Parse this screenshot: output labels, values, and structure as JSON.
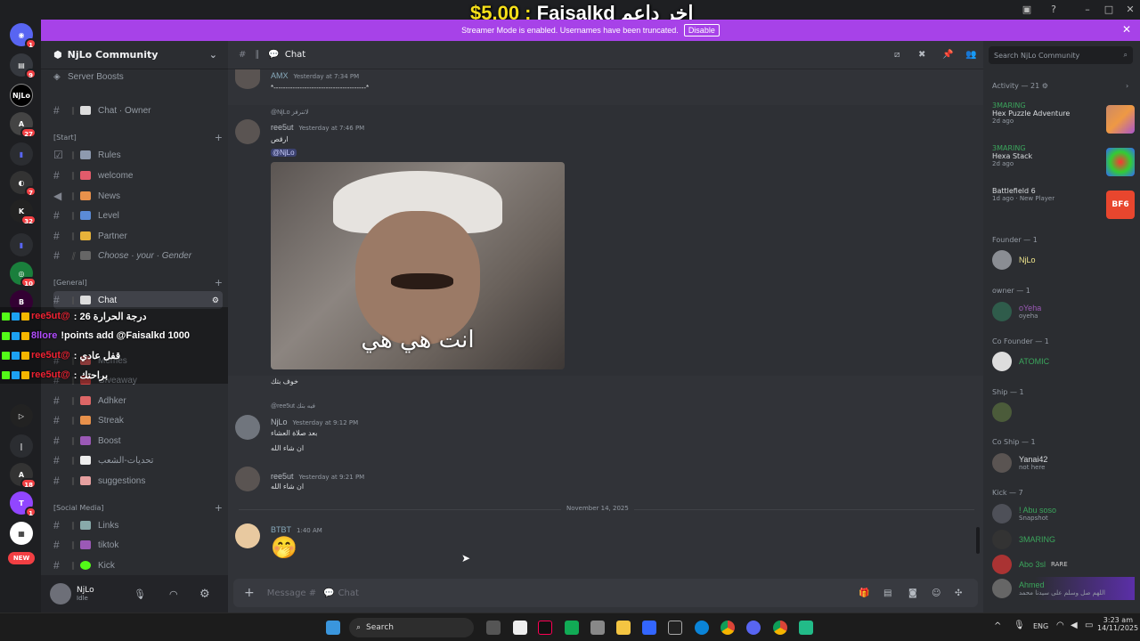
{
  "overlay": {
    "money": "$5.00 :",
    "name": "Faisalkd",
    "arabic": "اخر داعم"
  },
  "banner": {
    "text": "Streamer Mode is enabled. Usernames have been truncated.",
    "disable": "Disable"
  },
  "server": {
    "name": "NjLo Community",
    "boosts": "Server Boosts"
  },
  "channels": {
    "chat_owner": "Chat · Owner",
    "cat_start": "[Start]",
    "rules": "Rules",
    "welcome": "welcome",
    "news": "News",
    "level": "Level",
    "partner": "Partner",
    "gender": "Choose · your · Gender",
    "cat_general": "[General]",
    "chat": "Chat",
    "memes": "Memes",
    "giveaway": "Giveaway",
    "adhker": "Adhker",
    "streak": "Streak",
    "boost": "Boost",
    "challenges": "تحديات-الشعب",
    "suggestions": "suggestions",
    "cat_social": "[Social Media]",
    "links": "Links",
    "tiktok": "tiktok",
    "kick": "Kick"
  },
  "user": {
    "name": "NjLo",
    "status": "Idle"
  },
  "chat_overlay": [
    {
      "user": "ree5ut@",
      "text": ": درجة الحرارة 26"
    },
    {
      "user": "8llore",
      "text": "!points add @Faisalkd 1000"
    },
    {
      "user": "ree5ut@",
      "text": ": قفل عادي"
    },
    {
      "user": "ree5ut@",
      "text": ": براحتك"
    }
  ],
  "header": {
    "channel": "Chat"
  },
  "messages": {
    "m0_tag": "AMX",
    "m0_time": "Yesterday at 7:34 PM",
    "m0_text": "*---------------------------------------*",
    "m1_reply": "@NjLo لاتنرفز",
    "m1_user": "ree5ut",
    "m1_time": "Yesterday at 7:46 PM",
    "m1_text": "ارقص",
    "m1_mention": "@NjLo",
    "gif_caption": "انت هي هي",
    "m1_after": "خوف بتك",
    "m2_reply": "@ree5ut فيه بتك",
    "m2_user": "NjLo",
    "m2_time": "Yesterday at 9:12 PM",
    "m2_text1": "بعد صلاة العشاء",
    "m2_text2": "ان شاء الله",
    "m3_user": "ree5ut",
    "m3_time": "Yesterday at 9:21 PM",
    "m3_text": "ان شاء الله",
    "divider": "November 14, 2025",
    "m4_tag": "BTBT",
    "m4_time": "1:40 AM",
    "m4_emoji": "🤭"
  },
  "composer": {
    "placeholder": "Message #",
    "channel": "Chat"
  },
  "members": {
    "search": "Search NjLo Community",
    "activity": "Activity — 21",
    "acts": [
      {
        "user": "3MARING",
        "game": "Hex Puzzle Adventure",
        "time": "2d ago"
      },
      {
        "user": "3MARING",
        "game": "Hexa Stack",
        "time": "2d ago"
      },
      {
        "user": "",
        "game": "Battlefield 6",
        "time": "1d ago",
        "extra": "New Player"
      }
    ],
    "founder": "Founder — 1",
    "founder_name": "NjLo",
    "owner": "owner — 1",
    "owner_name": "oYeha",
    "owner_sub": "oyeha",
    "cofounder": "Co Founder — 1",
    "cofounder_name": "ATOMIC",
    "ship": "Ship — 1",
    "coship": "Co Ship — 1",
    "coship_name": "Yanai42",
    "coship_sub": "not here",
    "kick": "Kick — 7",
    "k1": "! Abu soso",
    "k1_sub": "Snapshot",
    "k2": "3MARING",
    "k3": "Abo 3sl",
    "k3_tag": "RARE",
    "k4": "Ahmed",
    "k4_sub": "اللهم صل وسلم على سيدنا محمد"
  },
  "taskbar": {
    "search": "Search",
    "lang": "ENG",
    "time": "3:23 am",
    "date": "14/11/2025"
  },
  "colors": {
    "accent": "#a742e8",
    "money": "#f7e01a"
  }
}
